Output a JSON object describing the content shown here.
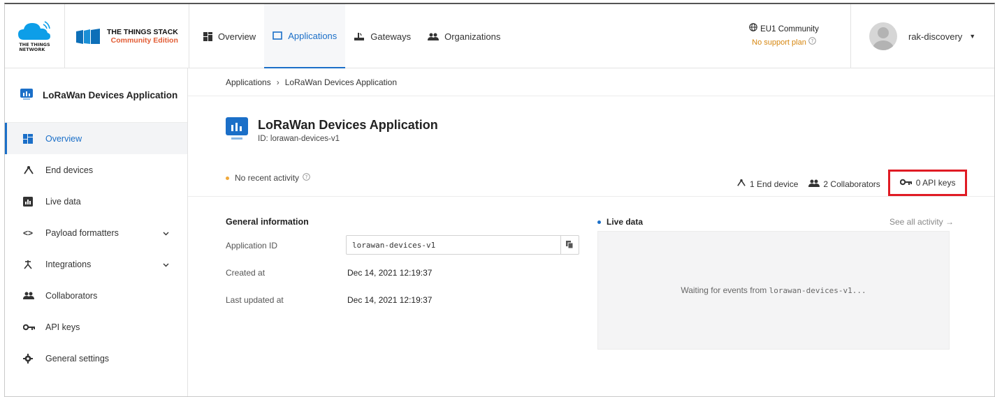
{
  "header": {
    "ttn_text": [
      "THE THINGS",
      "NETWORK"
    ],
    "tts_title": "THE THINGS STACK",
    "tts_sub": "Community Edition",
    "nav": [
      {
        "label": "Overview",
        "icon": "grid-icon"
      },
      {
        "label": "Applications",
        "icon": "window-icon",
        "active": true
      },
      {
        "label": "Gateways",
        "icon": "gateway-icon"
      },
      {
        "label": "Organizations",
        "icon": "people-icon"
      }
    ],
    "cluster_name": "EU1 Community",
    "support_plan": "No support plan",
    "username": "rak-discovery"
  },
  "sidebar": {
    "app_name": "LoRaWan Devices Application",
    "items": [
      {
        "label": "Overview",
        "icon": "grid-icon",
        "active": true
      },
      {
        "label": "End devices",
        "icon": "fork-icon"
      },
      {
        "label": "Live data",
        "icon": "bar-chart-icon"
      },
      {
        "label": "Payload formatters",
        "icon": "code-icon",
        "expandable": true
      },
      {
        "label": "Integrations",
        "icon": "integration-icon",
        "expandable": true
      },
      {
        "label": "Collaborators",
        "icon": "people-icon"
      },
      {
        "label": "API keys",
        "icon": "key-icon"
      },
      {
        "label": "General settings",
        "icon": "gear-icon"
      }
    ]
  },
  "main": {
    "breadcrumb": [
      "Applications",
      "LoRaWan Devices Application"
    ],
    "title": "LoRaWan Devices Application",
    "id_line": "ID: lorawan-devices-v1",
    "activity": "No recent activity",
    "stats": {
      "end_devices": "1 End device",
      "collaborators": "2 Collaborators",
      "api_keys": "0 API keys"
    },
    "general": {
      "title": "General information",
      "app_id_label": "Application ID",
      "app_id_value": "lorawan-devices-v1",
      "created_label": "Created at",
      "created_value": "Dec 14, 2021 12:19:37",
      "updated_label": "Last updated at",
      "updated_value": "Dec 14, 2021 12:19:37"
    },
    "live": {
      "title": "Live data",
      "see_all": "See all activity →",
      "waiting_prefix": "Waiting for events from ",
      "waiting_id": "lorawan-devices-v1..."
    }
  },
  "colors": {
    "accent": "#1b6fc8",
    "brand_orange": "#e25c34",
    "highlight_box": "#e01b24"
  }
}
